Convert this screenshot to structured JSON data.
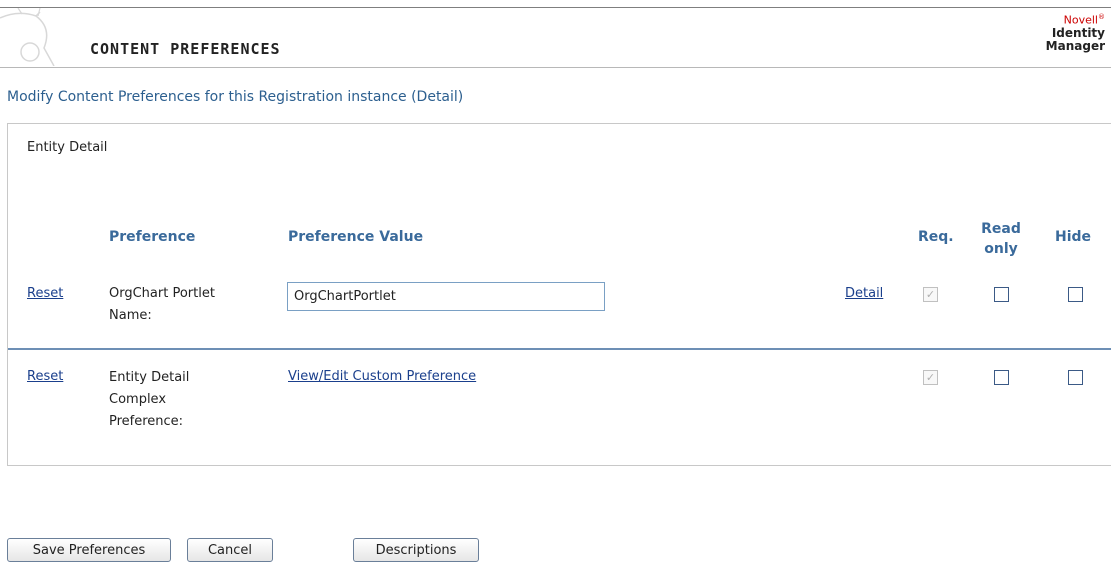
{
  "header": {
    "title": "CONTENT PREFERENCES",
    "brand_novell": "Novell",
    "brand_reg": "®",
    "brand_product_line1": "Identity",
    "brand_product_line2": "Manager"
  },
  "subtitle": "Modify Content Preferences for this Registration instance (Detail)",
  "panel": {
    "title": "Entity Detail",
    "columns": {
      "preference": "Preference",
      "value": "Preference Value",
      "req": "Req.",
      "read_only_line1": "Read",
      "read_only_line2": "only",
      "hide": "Hide"
    },
    "rows": [
      {
        "reset": "Reset",
        "name_line1": "OrgChart Portlet",
        "name_line2": "Name:",
        "value": "OrgChartPortlet",
        "detail": "Detail",
        "req": true,
        "read_only": false,
        "hide": false
      },
      {
        "reset": "Reset",
        "name_line1": "Entity Detail",
        "name_line2": "Complex",
        "name_line3": "Preference:",
        "value_link": "View/Edit Custom Preference",
        "req": true,
        "read_only": false,
        "hide": false
      }
    ]
  },
  "buttons": {
    "save": "Save Preferences",
    "cancel": "Cancel",
    "descriptions": "Descriptions"
  }
}
